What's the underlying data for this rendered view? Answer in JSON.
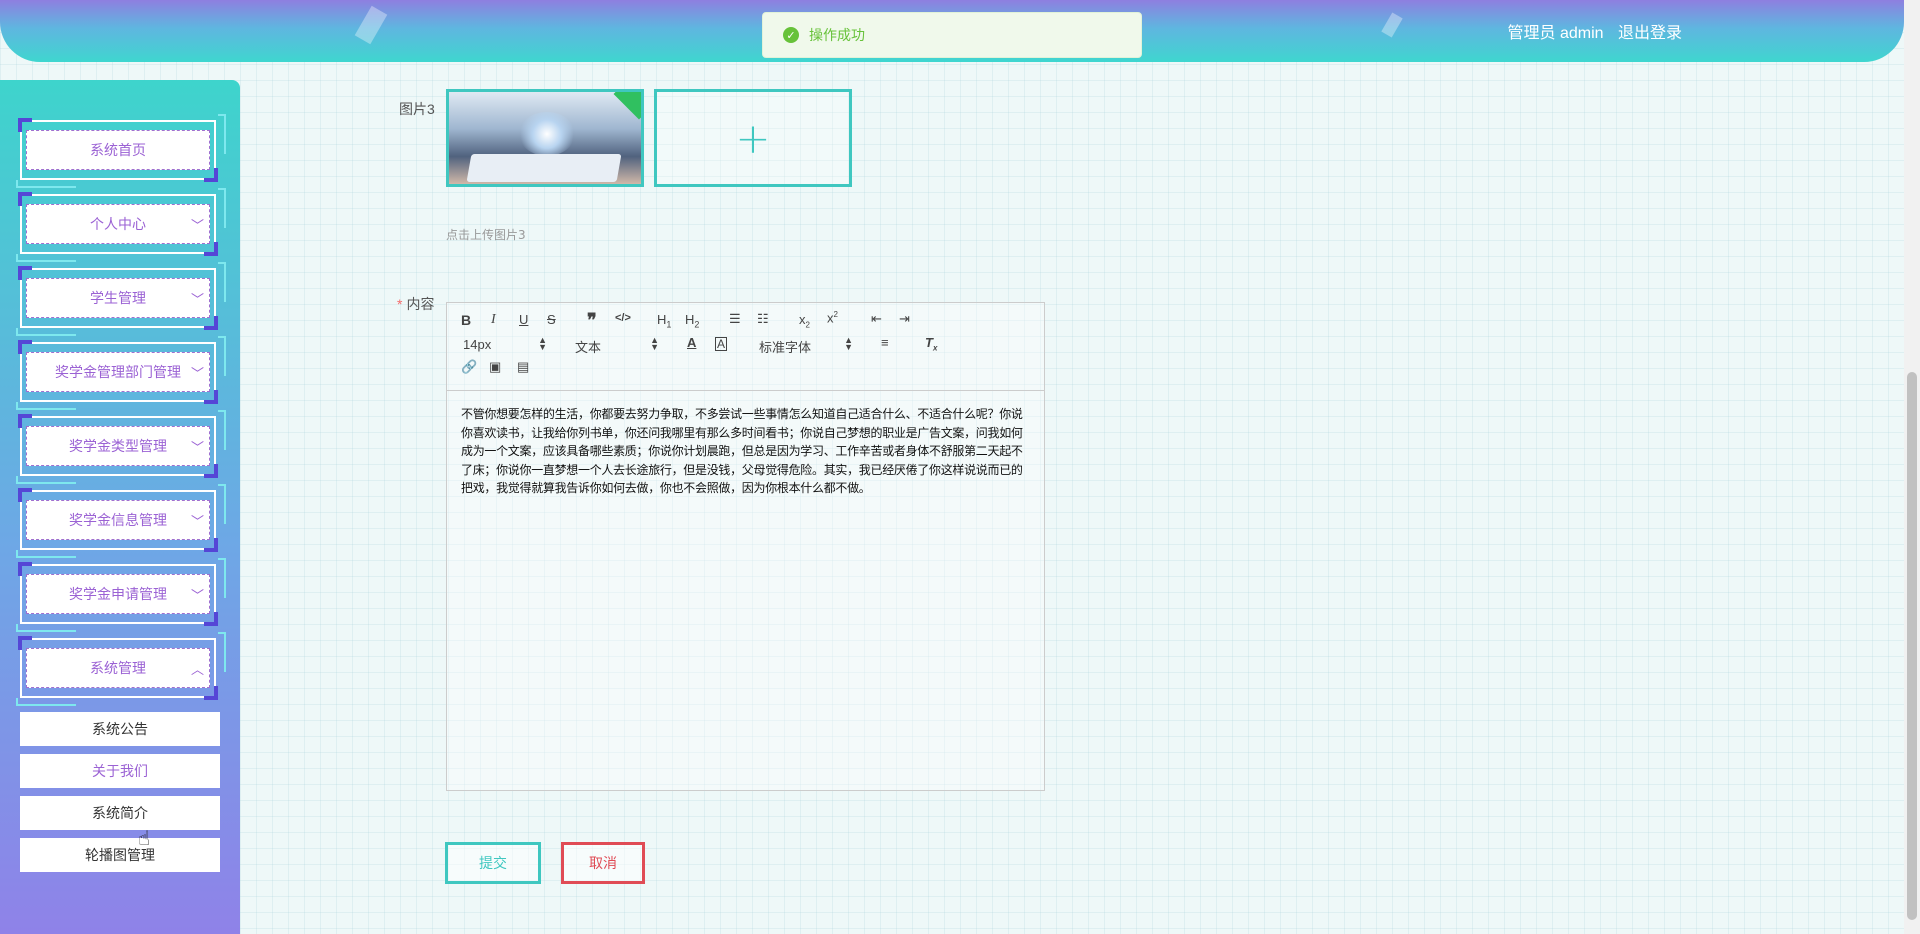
{
  "header": {
    "user_label": "管理员 admin",
    "logout_label": "退出登录"
  },
  "toast": {
    "message": "操作成功"
  },
  "sidebar": {
    "items": [
      {
        "label": "系统首页"
      },
      {
        "label": "个人中心"
      },
      {
        "label": "学生管理"
      },
      {
        "label": "奖学金管理部门管理"
      },
      {
        "label": "奖学金类型管理"
      },
      {
        "label": "奖学金信息管理"
      },
      {
        "label": "奖学金申请管理"
      },
      {
        "label": "系统管理"
      }
    ],
    "sub_items": [
      {
        "label": "系统公告"
      },
      {
        "label": "关于我们"
      },
      {
        "label": "系统简介"
      },
      {
        "label": "轮播图管理"
      }
    ]
  },
  "form": {
    "image3_label": "图片3",
    "upload_hint": "点击上传图片3",
    "content_label": "内容",
    "required_mark": "*",
    "editor": {
      "font_size": "14px",
      "header_type": "文本",
      "font_family": "标准字体",
      "content": "不管你想要怎样的生活，你都要去努力争取，不多尝试一些事情怎么知道自己适合什么、不适合什么呢？你说你喜欢读书，让我给你列书单，你还问我哪里有那么多时间看书；你说自己梦想的职业是广告文案，问我如何成为一个文案，应该具备哪些素质；你说你计划晨跑，但总是因为学习、工作辛苦或者身体不舒服第二天起不了床；你说你一直梦想一个人去长途旅行，但是没钱，父母觉得危险。其实，我已经厌倦了你这样说说而已的把戏，我觉得就算我告诉你如何去做，你也不会照做，因为你根本什么都不做。"
    },
    "submit_label": "提交",
    "cancel_label": "取消"
  },
  "toolbar_icons": [
    "bold-icon",
    "italic-icon",
    "underline-icon",
    "strike-icon",
    "blockquote-icon",
    "code-icon",
    "h1-icon",
    "h2-icon",
    "ordered-list-icon",
    "bullet-list-icon",
    "subscript-icon",
    "superscript-icon",
    "outdent-icon",
    "indent-icon",
    "font-color-icon",
    "background-color-icon",
    "align-icon",
    "clean-icon",
    "link-icon",
    "image-icon",
    "video-icon"
  ],
  "colors": {
    "accent": "#3fc7c0",
    "menu_text": "#9b62d4",
    "danger": "#e04b55",
    "success": "#67c23a"
  }
}
